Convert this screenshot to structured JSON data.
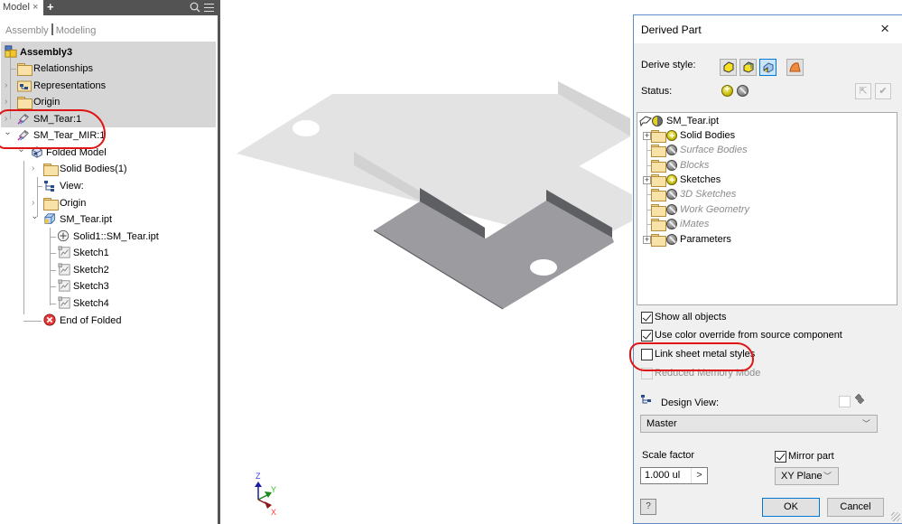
{
  "browser": {
    "tab_label": "Model",
    "tab_close": "×",
    "tab_add": "+",
    "mode_assembly": "Assembly",
    "mode_modeling": "Modeling",
    "tree": [
      {
        "label": "Assembly3",
        "bold": true
      },
      {
        "label": "Relationships"
      },
      {
        "label": "Representations"
      },
      {
        "label": "Origin"
      },
      {
        "label": "SM_Tear:1"
      },
      {
        "label": "SM_Tear_MIR:1"
      },
      {
        "label": "Folded Model"
      },
      {
        "label": "Solid Bodies(1)"
      },
      {
        "label": "View:"
      },
      {
        "label": "Origin"
      },
      {
        "label": "SM_Tear.ipt"
      },
      {
        "label": "Solid1::SM_Tear.ipt"
      },
      {
        "label": "Sketch1"
      },
      {
        "label": "Sketch2"
      },
      {
        "label": "Sketch3"
      },
      {
        "label": "Sketch4"
      },
      {
        "label": "End of Folded"
      }
    ]
  },
  "viewport": {
    "triad": {
      "x": "X",
      "y": "Y",
      "z": "Z"
    },
    "colors": {
      "light_part": "#e3e3e3",
      "dark_part": "#9c9ca0",
      "dark_flange": "#5e5f63"
    }
  },
  "dialog": {
    "title": "Derived Part",
    "close": "×",
    "derive_style_label": "Derive style:",
    "status_label": "Status:",
    "tree": [
      {
        "label": "SM_Tear.ipt",
        "state": "partial",
        "expand": false
      },
      {
        "label": "Solid Bodies",
        "state": "include",
        "expand": true,
        "dim": false
      },
      {
        "label": "Surface Bodies",
        "state": "exclude",
        "expand": false,
        "dim": true
      },
      {
        "label": "Blocks",
        "state": "exclude",
        "expand": false,
        "dim": true
      },
      {
        "label": "Sketches",
        "state": "include",
        "expand": true,
        "dim": false
      },
      {
        "label": "3D Sketches",
        "state": "exclude",
        "expand": false,
        "dim": true
      },
      {
        "label": "Work Geometry",
        "state": "exclude",
        "expand": false,
        "dim": true
      },
      {
        "label": "iMates",
        "state": "exclude",
        "expand": false,
        "dim": true
      },
      {
        "label": "Parameters",
        "state": "exclude",
        "expand": true,
        "dim": false
      }
    ],
    "options": {
      "show_all_objects": {
        "label": "Show all objects",
        "checked": true
      },
      "use_color_override": {
        "label": "Use color override from source component",
        "checked": true
      },
      "link_sheet_metal": {
        "label": "Link sheet metal styles",
        "checked": false
      },
      "reduced_memory": {
        "label": "Reduced Memory Mode",
        "checked": false,
        "disabled": true
      }
    },
    "design_view_label": "Design View:",
    "design_view_value": "Master",
    "scale_factor_label": "Scale factor",
    "scale_factor_value": "1.000 ul",
    "scale_arrow": ">",
    "mirror_part_label": "Mirror part",
    "mirror_part_checked": true,
    "mirror_plane_value": "XY Plane",
    "ok_label": "OK",
    "cancel_label": "Cancel",
    "help_label": "?"
  }
}
